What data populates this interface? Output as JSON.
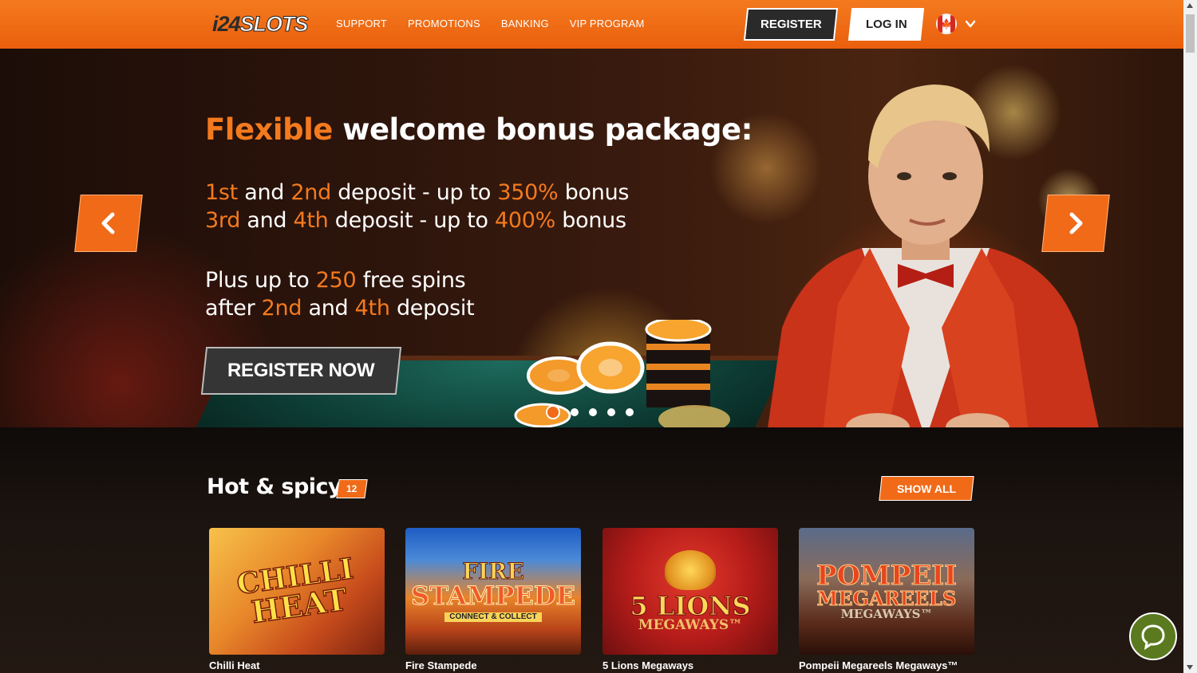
{
  "header": {
    "logo_a": "i24",
    "logo_b": "SLOTS",
    "nav": [
      "SUPPORT",
      "PROMOTIONS",
      "BANKING",
      "VIP PROGRAM"
    ],
    "register_label": "REGISTER",
    "login_label": "LOG IN",
    "flag_icon": "canada-flag-icon",
    "flag_glyph": "🍁"
  },
  "hero": {
    "title_hl": "Flexible",
    "title_rest": " welcome bonus package:",
    "line1": [
      "1st",
      " and ",
      "2nd",
      " deposit - up to ",
      "350%",
      " bonus"
    ],
    "line2": [
      "3rd",
      " and ",
      "4th",
      " deposit - up to ",
      "400%",
      " bonus"
    ],
    "line3": [
      "Plus up to ",
      "250",
      " free spins"
    ],
    "line4": [
      "after ",
      "2nd",
      " and ",
      "4th",
      " deposit"
    ],
    "cta_label": "REGISTER NOW",
    "slides_count": 5,
    "active_slide": 1
  },
  "section": {
    "title": "Hot & spicy",
    "count": "12",
    "show_all_label": "SHOW ALL"
  },
  "games": [
    {
      "name": "Chilli Heat",
      "art_line1": "CHILLI",
      "art_line2": "HEAT"
    },
    {
      "name": "Fire Stampede",
      "art_line1": "FIRE",
      "art_line2": "STAMPEDE",
      "art_line3": "CONNECT & COLLECT"
    },
    {
      "name": "5 Lions Megaways",
      "art_line1": "5 LIONS",
      "art_line2": "MEGAWAYS™"
    },
    {
      "name": "Pompeii Megareels Megaways™",
      "art_line1": "POMPEII",
      "art_line2": "MEGAREELS",
      "art_line3": "MEGAWAYS™"
    }
  ],
  "colors": {
    "accent": "#f06a18",
    "header_top": "#f47a1e",
    "chat_bg": "#5b7a1f"
  }
}
